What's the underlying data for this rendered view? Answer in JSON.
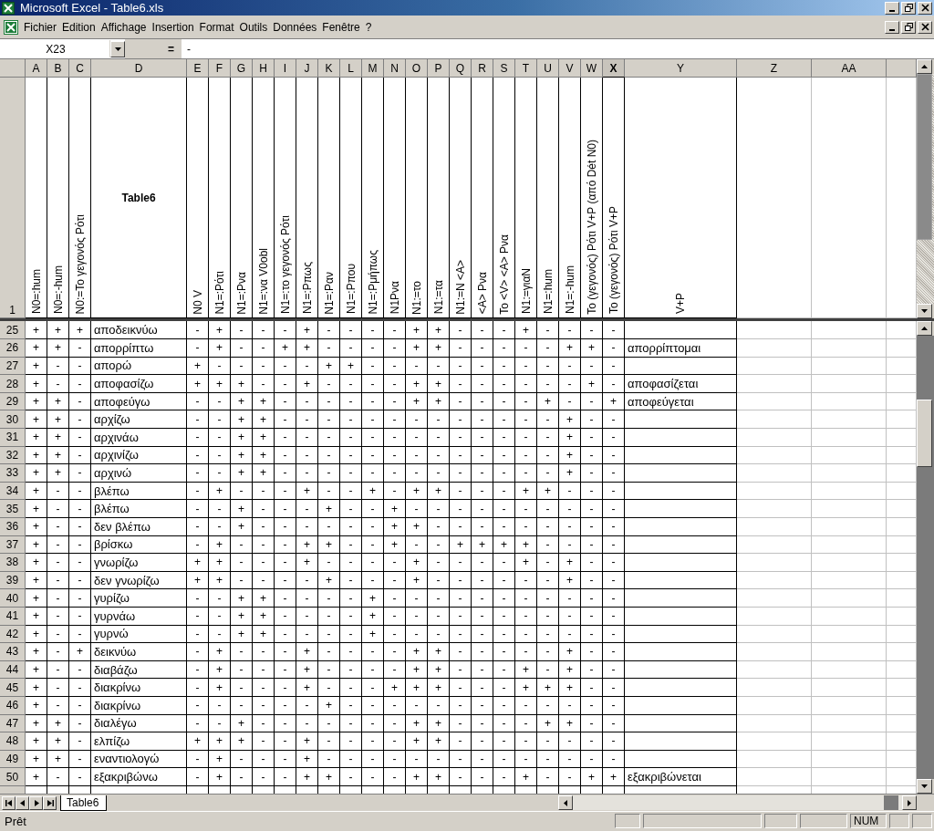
{
  "window": {
    "title": "Microsoft Excel - Table6.xls"
  },
  "menu": [
    "Fichier",
    "Edition",
    "Affichage",
    "Insertion",
    "Format",
    "Outils",
    "Données",
    "Fenêtre",
    "?"
  ],
  "formula_bar": {
    "cell_ref": "X23",
    "equals": "=",
    "value": "-"
  },
  "columns": [
    {
      "label": "A",
      "selected": false
    },
    {
      "label": "B",
      "selected": false
    },
    {
      "label": "C",
      "selected": false
    },
    {
      "label": "D",
      "selected": false
    },
    {
      "label": "E",
      "selected": false
    },
    {
      "label": "F",
      "selected": false
    },
    {
      "label": "G",
      "selected": false
    },
    {
      "label": "H",
      "selected": false
    },
    {
      "label": "I",
      "selected": false
    },
    {
      "label": "J",
      "selected": false
    },
    {
      "label": "K",
      "selected": false
    },
    {
      "label": "L",
      "selected": false
    },
    {
      "label": "M",
      "selected": false
    },
    {
      "label": "N",
      "selected": false
    },
    {
      "label": "O",
      "selected": false
    },
    {
      "label": "P",
      "selected": false
    },
    {
      "label": "Q",
      "selected": false
    },
    {
      "label": "R",
      "selected": false
    },
    {
      "label": "S",
      "selected": false
    },
    {
      "label": "T",
      "selected": false
    },
    {
      "label": "U",
      "selected": false
    },
    {
      "label": "V",
      "selected": false
    },
    {
      "label": "W",
      "selected": false
    },
    {
      "label": "X",
      "selected": true
    },
    {
      "label": "Y",
      "selected": false
    },
    {
      "label": "Z",
      "selected": false
    },
    {
      "label": "AA",
      "selected": false
    }
  ],
  "header_row": {
    "number": "1",
    "cells": [
      {
        "kind": "vertical",
        "text": "N0=:hum"
      },
      {
        "kind": "vertical",
        "text": "N0=:-hum"
      },
      {
        "kind": "vertical",
        "text": "N0:=Το γεγονός Ρότι"
      },
      {
        "kind": "title",
        "text": "Table6"
      },
      {
        "kind": "vertical",
        "text": "N0 V"
      },
      {
        "kind": "vertical",
        "text": "N1=:Ρότι"
      },
      {
        "kind": "vertical",
        "text": "N1=:Ρνα"
      },
      {
        "kind": "vertical",
        "text": "N1=:να V0obl"
      },
      {
        "kind": "vertical",
        "text": "N1=:το γεγονός Ρότι"
      },
      {
        "kind": "vertical",
        "text": "N1=:Ρπως"
      },
      {
        "kind": "vertical",
        "text": "N1=:Ραν"
      },
      {
        "kind": "vertical",
        "text": "N1=:Ρπου"
      },
      {
        "kind": "vertical",
        "text": "N1=:Ρμήπως"
      },
      {
        "kind": "vertical",
        "text": "N1Ρνα"
      },
      {
        "kind": "vertical",
        "text": "N1:=το"
      },
      {
        "kind": "vertical",
        "text": "N1:=τα"
      },
      {
        "kind": "vertical",
        "text": "N1:=N <A>"
      },
      {
        "kind": "vertical",
        "text": "<A> Ρνα"
      },
      {
        "kind": "vertical",
        "text": "Το <V> <A> Ρνα"
      },
      {
        "kind": "vertical",
        "text": "N1:=γιαN"
      },
      {
        "kind": "vertical",
        "text": "N1=:hum"
      },
      {
        "kind": "vertical",
        "text": "N1=:-hum"
      },
      {
        "kind": "vertical",
        "text": "Το (γεγονός) Ρότι V+P (από Dét N0)"
      },
      {
        "kind": "vertical",
        "text": "Το (γεγονός) Ρότι V+P"
      },
      {
        "kind": "vertical",
        "text": "V+P"
      }
    ]
  },
  "rows": [
    {
      "number": "25",
      "cells": [
        "+",
        "+",
        "+",
        "αποδεικνύω",
        "-",
        "+",
        "-",
        "-",
        "-",
        "+",
        "-",
        "-",
        "-",
        "-",
        "+",
        "+",
        "-",
        "-",
        "-",
        "+",
        "-",
        "-",
        "-",
        "-"
      ]
    },
    {
      "number": "26",
      "cells": [
        "+",
        "+",
        "-",
        "απορρίπτω",
        "-",
        "+",
        "-",
        "-",
        "+",
        "+",
        "-",
        "-",
        "-",
        "-",
        "+",
        "+",
        "-",
        "-",
        "-",
        "-",
        "-",
        "+",
        "+",
        "-"
      ],
      "v_p": "απορρίπτομαι"
    },
    {
      "number": "27",
      "cells": [
        "+",
        "-",
        "-",
        "απορώ",
        "+",
        "-",
        "-",
        "-",
        "-",
        "-",
        "+",
        "+",
        "-",
        "-",
        "-",
        "-",
        "-",
        "-",
        "-",
        "-",
        "-",
        "-",
        "-",
        "-"
      ]
    },
    {
      "number": "28",
      "cells": [
        "+",
        "-",
        "-",
        "αποφασίζω",
        "+",
        "+",
        "+",
        "-",
        "-",
        "+",
        "-",
        "-",
        "-",
        "-",
        "+",
        "+",
        "-",
        "-",
        "-",
        "-",
        "-",
        "-",
        "+",
        "-"
      ],
      "v_p": "αποφασίζεται"
    },
    {
      "number": "29",
      "cells": [
        "+",
        "+",
        "-",
        "αποφεύγω",
        "-",
        "-",
        "+",
        "+",
        "-",
        "-",
        "-",
        "-",
        "-",
        "-",
        "+",
        "+",
        "-",
        "-",
        "-",
        "-",
        "+",
        "-",
        "-",
        "+"
      ],
      "v_p": "αποφεύγεται"
    },
    {
      "number": "30",
      "cells": [
        "+",
        "+",
        "-",
        "αρχίζω",
        "-",
        "-",
        "+",
        "+",
        "-",
        "-",
        "-",
        "-",
        "-",
        "-",
        "-",
        "-",
        "-",
        "-",
        "-",
        "-",
        "-",
        "+",
        "-",
        "-"
      ]
    },
    {
      "number": "31",
      "cells": [
        "+",
        "+",
        "-",
        "αρχινάω",
        "-",
        "-",
        "+",
        "+",
        "-",
        "-",
        "-",
        "-",
        "-",
        "-",
        "-",
        "-",
        "-",
        "-",
        "-",
        "-",
        "-",
        "+",
        "-",
        "-"
      ]
    },
    {
      "number": "32",
      "cells": [
        "+",
        "+",
        "-",
        "αρχινίζω",
        "-",
        "-",
        "+",
        "+",
        "-",
        "-",
        "-",
        "-",
        "-",
        "-",
        "-",
        "-",
        "-",
        "-",
        "-",
        "-",
        "-",
        "+",
        "-",
        "-"
      ]
    },
    {
      "number": "33",
      "cells": [
        "+",
        "+",
        "-",
        "αρχινώ",
        "-",
        "-",
        "+",
        "+",
        "-",
        "-",
        "-",
        "-",
        "-",
        "-",
        "-",
        "-",
        "-",
        "-",
        "-",
        "-",
        "-",
        "+",
        "-",
        "-"
      ]
    },
    {
      "number": "34",
      "cells": [
        "+",
        "-",
        "-",
        "βλέπω",
        "-",
        "+",
        "-",
        "-",
        "-",
        "+",
        "-",
        "-",
        "+",
        "-",
        "+",
        "+",
        "-",
        "-",
        "-",
        "+",
        "+",
        "-",
        "-",
        "-"
      ]
    },
    {
      "number": "35",
      "cells": [
        "+",
        "-",
        "-",
        "βλέπω",
        "-",
        "-",
        "+",
        "-",
        "-",
        "-",
        "+",
        "-",
        "-",
        "+",
        "-",
        "-",
        "-",
        "-",
        "-",
        "-",
        "-",
        "-",
        "-",
        "-"
      ]
    },
    {
      "number": "36",
      "cells": [
        "+",
        "-",
        "-",
        "δεν βλέπω",
        "-",
        "-",
        "+",
        "-",
        "-",
        "-",
        "-",
        "-",
        "-",
        "+",
        "+",
        "-",
        "-",
        "-",
        "-",
        "-",
        "-",
        "-",
        "-",
        "-"
      ]
    },
    {
      "number": "37",
      "cells": [
        "+",
        "-",
        "-",
        "βρίσκω",
        "-",
        "+",
        "-",
        "-",
        "-",
        "+",
        "+",
        "-",
        "-",
        "+",
        "-",
        "-",
        "+",
        "+",
        "+",
        "+",
        "-",
        "-",
        "-",
        "-"
      ]
    },
    {
      "number": "38",
      "cells": [
        "+",
        "-",
        "-",
        "γνωρίζω",
        "+",
        "+",
        "-",
        "-",
        "-",
        "+",
        "-",
        "-",
        "-",
        "-",
        "+",
        "-",
        "-",
        "-",
        "-",
        "+",
        "-",
        "+",
        "-",
        "-"
      ]
    },
    {
      "number": "39",
      "cells": [
        "+",
        "-",
        "-",
        "δεν γνωρίζω",
        "+",
        "+",
        "-",
        "-",
        "-",
        "-",
        "+",
        "-",
        "-",
        "-",
        "+",
        "-",
        "-",
        "-",
        "-",
        "-",
        "-",
        "+",
        "-",
        "-"
      ]
    },
    {
      "number": "40",
      "cells": [
        "+",
        "-",
        "-",
        "γυρίζω",
        "-",
        "-",
        "+",
        "+",
        "-",
        "-",
        "-",
        "-",
        "+",
        "-",
        "-",
        "-",
        "-",
        "-",
        "-",
        "-",
        "-",
        "-",
        "-",
        "-"
      ]
    },
    {
      "number": "41",
      "cells": [
        "+",
        "-",
        "-",
        "γυρνάω",
        "-",
        "-",
        "+",
        "+",
        "-",
        "-",
        "-",
        "-",
        "+",
        "-",
        "-",
        "-",
        "-",
        "-",
        "-",
        "-",
        "-",
        "-",
        "-",
        "-"
      ]
    },
    {
      "number": "42",
      "cells": [
        "+",
        "-",
        "-",
        "γυρνώ",
        "-",
        "-",
        "+",
        "+",
        "-",
        "-",
        "-",
        "-",
        "+",
        "-",
        "-",
        "-",
        "-",
        "-",
        "-",
        "-",
        "-",
        "-",
        "-",
        "-"
      ]
    },
    {
      "number": "43",
      "cells": [
        "+",
        "-",
        "+",
        "δεικνύω",
        "-",
        "+",
        "-",
        "-",
        "-",
        "+",
        "-",
        "-",
        "-",
        "-",
        "+",
        "+",
        "-",
        "-",
        "-",
        "-",
        "-",
        "+",
        "-",
        "-"
      ]
    },
    {
      "number": "44",
      "cells": [
        "+",
        "-",
        "-",
        "διαβάζω",
        "-",
        "+",
        "-",
        "-",
        "-",
        "+",
        "-",
        "-",
        "-",
        "-",
        "+",
        "+",
        "-",
        "-",
        "-",
        "+",
        "-",
        "+",
        "-",
        "-"
      ]
    },
    {
      "number": "45",
      "cells": [
        "+",
        "-",
        "-",
        "διακρίνω",
        "-",
        "+",
        "-",
        "-",
        "-",
        "+",
        "-",
        "-",
        "-",
        "+",
        "+",
        "+",
        "-",
        "-",
        "-",
        "+",
        "+",
        "+",
        "-",
        "-"
      ]
    },
    {
      "number": "46",
      "cells": [
        "+",
        "-",
        "-",
        "διακρίνω",
        "-",
        "-",
        "-",
        "-",
        "-",
        "-",
        "+",
        "-",
        "-",
        "-",
        "-",
        "-",
        "-",
        "-",
        "-",
        "-",
        "-",
        "-",
        "-",
        "-"
      ]
    },
    {
      "number": "47",
      "cells": [
        "+",
        "+",
        "-",
        "διαλέγω",
        "-",
        "-",
        "+",
        "-",
        "-",
        "-",
        "-",
        "-",
        "-",
        "-",
        "+",
        "+",
        "-",
        "-",
        "-",
        "-",
        "+",
        "+",
        "-",
        "-"
      ]
    },
    {
      "number": "48",
      "cells": [
        "+",
        "+",
        "-",
        "ελπίζω",
        "+",
        "+",
        "+",
        "-",
        "-",
        "+",
        "-",
        "-",
        "-",
        "-",
        "+",
        "+",
        "-",
        "-",
        "-",
        "-",
        "-",
        "-",
        "-",
        "-"
      ]
    },
    {
      "number": "49",
      "cells": [
        "+",
        "+",
        "-",
        "εναντιολογώ",
        "-",
        "+",
        "-",
        "-",
        "-",
        "+",
        "-",
        "-",
        "-",
        "-",
        "-",
        "-",
        "-",
        "-",
        "-",
        "-",
        "-",
        "-",
        "-",
        "-"
      ]
    },
    {
      "number": "50",
      "cells": [
        "+",
        "-",
        "-",
        "εξακριβώνω",
        "-",
        "+",
        "-",
        "-",
        "-",
        "+",
        "+",
        "-",
        "-",
        "-",
        "+",
        "+",
        "-",
        "-",
        "-",
        "+",
        "-",
        "-",
        "+",
        "+"
      ],
      "v_p": "εξακριβώνεται"
    }
  ],
  "sheet_tabs": [
    {
      "label": "Table6",
      "selected": true
    }
  ],
  "status_bar": {
    "text": "Prêt",
    "indicator": "NUM"
  }
}
